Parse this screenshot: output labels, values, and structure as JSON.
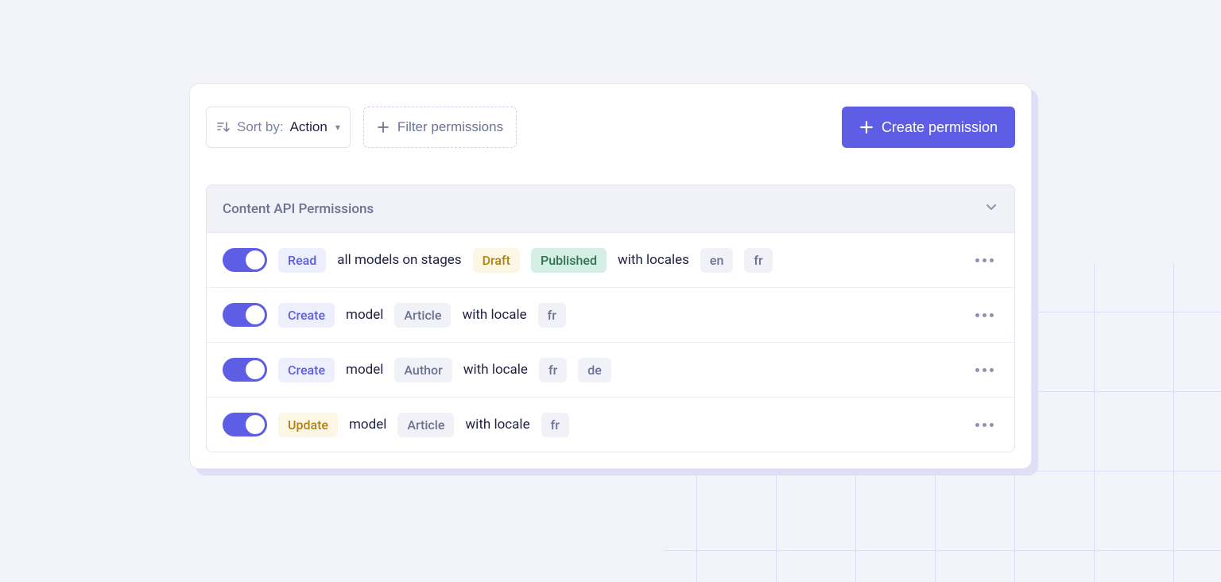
{
  "toolbar": {
    "sort_label": "Sort by:",
    "sort_value": "Action",
    "filter_label": "Filter permissions",
    "create_label": "Create permission"
  },
  "section": {
    "title": "Content API Permissions"
  },
  "labels": {
    "all_models_stages": "all models on stages",
    "with_locales": "with locales",
    "model": "model",
    "with_locale": "with locale"
  },
  "permissions": [
    {
      "enabled": true,
      "action": "Read",
      "action_style": "read",
      "scope": "all_models",
      "stages": [
        "Draft",
        "Published"
      ],
      "locales": [
        "en",
        "fr"
      ]
    },
    {
      "enabled": true,
      "action": "Create",
      "action_style": "create",
      "scope": "model",
      "model": "Article",
      "locales": [
        "fr"
      ]
    },
    {
      "enabled": true,
      "action": "Create",
      "action_style": "create",
      "scope": "model",
      "model": "Author",
      "locales": [
        "fr",
        "de"
      ]
    },
    {
      "enabled": true,
      "action": "Update",
      "action_style": "update",
      "scope": "model",
      "model": "Article",
      "locales": [
        "fr"
      ]
    }
  ]
}
